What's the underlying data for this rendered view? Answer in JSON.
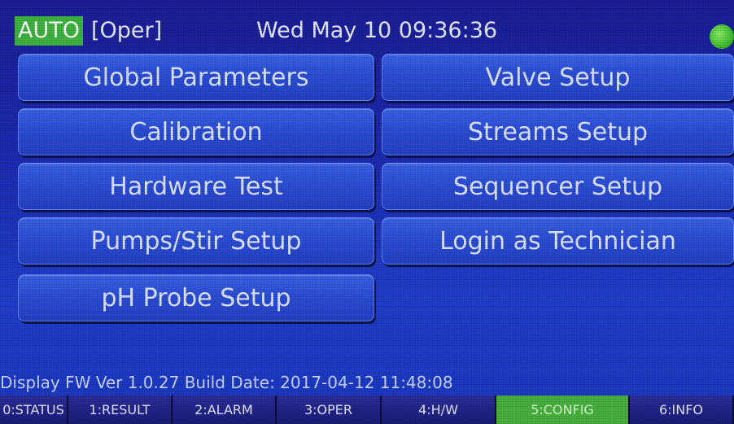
{
  "status_bar": {
    "mode": "AUTO",
    "state": "[Oper]",
    "datetime": "Wed May 10 09:36:36",
    "indicator_color": "#3fbe2e"
  },
  "menu": {
    "left": [
      "Global Parameters",
      "Calibration",
      "Hardware Test",
      "Pumps/Stir Setup",
      "pH Probe Setup"
    ],
    "right": [
      "Valve Setup",
      "Streams Setup",
      "Sequencer Setup",
      "Login as Technician"
    ]
  },
  "footer": {
    "firmware_info": "Display FW Ver 1.0.27 Build Date: 2017-04-12 11:48:08"
  },
  "tabs": [
    {
      "label": "0:STATUS",
      "active": false
    },
    {
      "label": "1:RESULT",
      "active": false
    },
    {
      "label": "2:ALARM",
      "active": false
    },
    {
      "label": "3:OPER",
      "active": false
    },
    {
      "label": "4:H/W",
      "active": false
    },
    {
      "label": "5:CONFIG",
      "active": true
    },
    {
      "label": "6:INFO",
      "active": false
    }
  ],
  "colors": {
    "background": "#1f3fcc",
    "button": "#2c4fd8",
    "active_tab": "#49b23f"
  }
}
